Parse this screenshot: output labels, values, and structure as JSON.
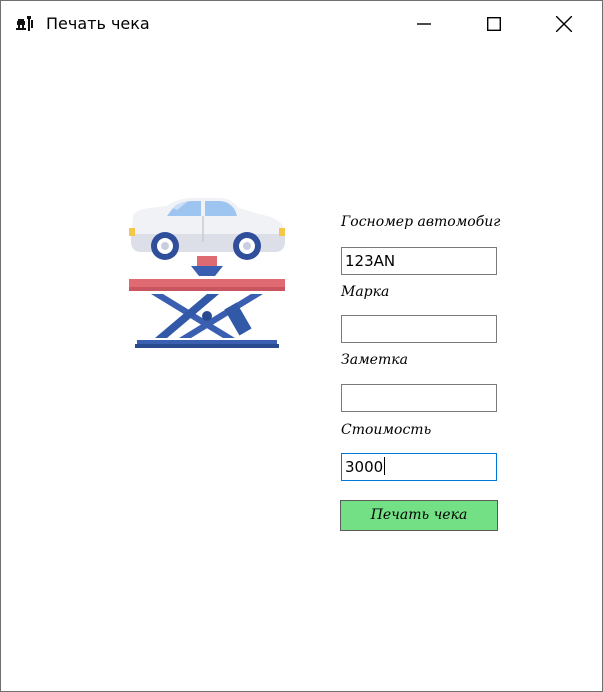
{
  "window": {
    "title": "Печать чека",
    "app_icon": "car-repair-icon",
    "controls": {
      "minimize": "minimize-icon",
      "maximize": "maximize-icon",
      "close": "close-icon"
    }
  },
  "form": {
    "plate_label": "Госномер автомобиг",
    "plate_value": "123AN",
    "brand_label": "Марка",
    "brand_value": "",
    "note_label": "Заметка",
    "note_value": "",
    "cost_label": "Стоимость",
    "cost_value": "3000",
    "print_button": "Печать чека"
  },
  "colors": {
    "button_bg": "#73e085",
    "focus_border": "#0078d7",
    "lift_bar": "#e06a72",
    "lift_frame": "#3b5fb0"
  },
  "illustration": "car-on-lift-icon"
}
